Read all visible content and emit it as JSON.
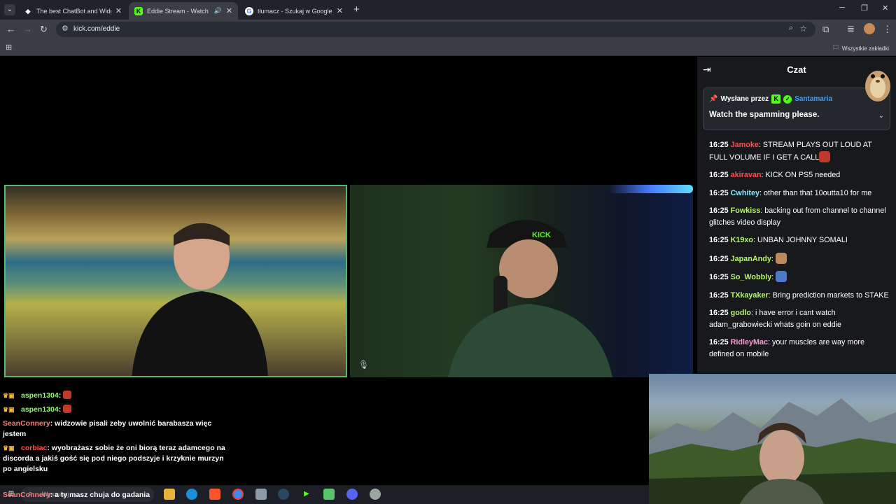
{
  "browser": {
    "tabs": [
      {
        "title": "The best ChatBot and Widgets",
        "favicon": "diamond-icon",
        "active": false
      },
      {
        "title": "Eddie Stream - Watch Live",
        "favicon": "kick-icon",
        "active": true,
        "audio": "speaker-icon"
      },
      {
        "title": "tłumacz - Szukaj w Google",
        "favicon": "google-icon",
        "active": false
      }
    ],
    "url": "kick.com/eddie",
    "bookmarks_all": "Wszystkie zakładki"
  },
  "chat": {
    "title": "Czat",
    "pinned": {
      "prefix": "Wysłane przez",
      "author": "Santamaria",
      "message": "Watch the spamming please."
    },
    "messages": [
      {
        "time": "16:25",
        "user": "Jamoke",
        "color": "#ff4d4d",
        "text": "STREAM PLAYS OUT LOUD AT FULL VOLUME IF I GET A CALL",
        "emote": true,
        "emote_color": "#c0392b"
      },
      {
        "time": "16:25",
        "user": "akiravan",
        "color": "#ff4d4d",
        "text": "KICK ON PS5 needed"
      },
      {
        "time": "16:25",
        "user": "Cwhitey",
        "color": "#8be9fd",
        "text": "other than that 10outta10 for me"
      },
      {
        "time": "16:25",
        "user": "Fowkiss",
        "color": "#b6f46e",
        "text": "backing out from channel to channel glitches video display"
      },
      {
        "time": "16:25",
        "user": "K19xo",
        "color": "#b6f46e",
        "text": "UNBAN JOHNNY SOMALI"
      },
      {
        "time": "16:25",
        "user": "JapanAndy",
        "color": "#b6f46e",
        "text": "",
        "emote": true,
        "emote_color": "#b98b5c"
      },
      {
        "time": "16:25",
        "user": "So_Wobbly",
        "color": "#b6f46e",
        "text": "",
        "emote": true,
        "emote_color": "#4c7ac9"
      },
      {
        "time": "16:25",
        "user": "TXkayaker",
        "color": "#b6f46e",
        "text": "Bring prediction markets to STAKE"
      },
      {
        "time": "16:25",
        "user": "godlo",
        "color": "#b6f46e",
        "text": "i have error i cant watch adam_grabowiecki whats goin on eddie"
      },
      {
        "time": "16:25",
        "user": "RidleyMac",
        "color": "#ff9bd2",
        "text": "your muscles are way more defined on mobile"
      }
    ]
  },
  "overlay_chat": [
    {
      "user": "aspen1304",
      "color": "#8dff62",
      "text": "",
      "badges": true,
      "emote": true
    },
    {
      "user": "aspen1304",
      "color": "#8dff62",
      "text": "",
      "badges": true,
      "emote": true
    },
    {
      "user": "SeanConnery",
      "color": "#ff7b7b",
      "text": "widzowie pisali zeby uwolnić barabasza więc jestem",
      "badges": false
    },
    {
      "user": "corbiac",
      "color": "#ff4d4d",
      "text": "wyobrażasz sobie że oni biorą teraz adamcego na discorda a jakiś gość się pod niego podszyje i krzyknie murzyn po angielsku",
      "badges": true
    }
  ],
  "overlay_bottom": {
    "user": "SeanConnery",
    "text": "a ty masz chuja do gadania"
  },
  "taskbar": {
    "search_placeholder": "Wyszukaj",
    "icons": [
      "windows-icon",
      "file-explorer-icon",
      "edge-icon",
      "brave-icon",
      "chrome-icon",
      "app-icon",
      "steam-icon",
      "green-arrow-icon",
      "app-icon",
      "discord-icon",
      "bot-icon"
    ]
  },
  "colors": {
    "kick_green": "#53fc18",
    "link_blue": "#3aa0ff",
    "cam_border": "#53b96f"
  }
}
